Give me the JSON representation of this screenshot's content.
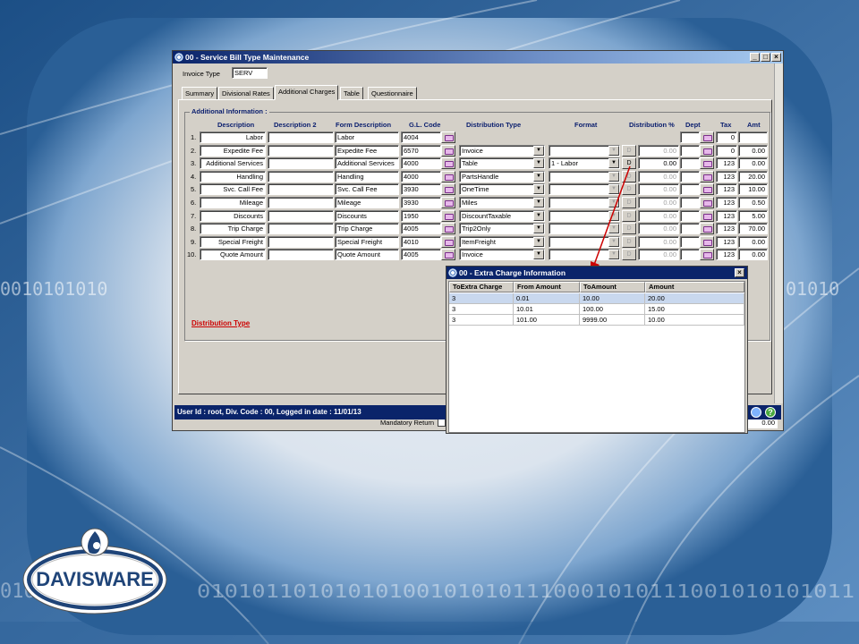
{
  "window": {
    "title": "00 - Service Bill Type Maintenance",
    "invoice_type_label": "Invoice Type",
    "invoice_type_value": "SERV"
  },
  "tabs": [
    {
      "label": "Summary"
    },
    {
      "label": "Divisional Rates"
    },
    {
      "label": "Additional Charges"
    },
    {
      "label": "Table"
    },
    {
      "label": "Questionnaire"
    }
  ],
  "section": {
    "title": "Additional Information :",
    "link": "Distribution Type"
  },
  "columns": {
    "description": "Description",
    "description2": "Description 2",
    "form_description": "Form Description",
    "gl_code": "G.L. Code",
    "distribution_type": "Distribution Type",
    "format": "Format",
    "distribution_pct": "Distribution %",
    "dept": "Dept",
    "tax": "Tax",
    "amt": "Amt"
  },
  "rows": [
    {
      "num": "1.",
      "desc": "Labor",
      "form": "Labor",
      "gl": "4004",
      "dist": "",
      "format": "",
      "d": "",
      "pct": "",
      "tax": "0",
      "amt": ""
    },
    {
      "num": "2.",
      "desc": "Expedite Fee",
      "form": "Expedite Fee",
      "gl": "6570",
      "dist": "Invoice",
      "format": "",
      "d": "D",
      "pct": "0.00",
      "tax": "0",
      "amt": "0.00"
    },
    {
      "num": "3.",
      "desc": "Additional Services",
      "form": "Additional Services",
      "gl": "4000",
      "dist": "Table",
      "format": "1 - Labor",
      "d": "D",
      "pct": "0.00",
      "tax": "123",
      "amt": "0.00"
    },
    {
      "num": "4.",
      "desc": "Handling",
      "form": "Handling",
      "gl": "4000",
      "dist": "PartsHandle",
      "format": "",
      "d": "D",
      "pct": "0.00",
      "tax": "123",
      "amt": "20.00"
    },
    {
      "num": "5.",
      "desc": "Svc. Call Fee",
      "form": "Svc. Call Fee",
      "gl": "3930",
      "dist": "OneTime",
      "format": "",
      "d": "D",
      "pct": "0.00",
      "tax": "123",
      "amt": "10.00"
    },
    {
      "num": "6.",
      "desc": "Mileage",
      "form": "Mileage",
      "gl": "3930",
      "dist": "Miles",
      "format": "",
      "d": "D",
      "pct": "0.00",
      "tax": "123",
      "amt": "0.50"
    },
    {
      "num": "7.",
      "desc": "Discounts",
      "form": "Discounts",
      "gl": "1950",
      "dist": "DiscountTaxable",
      "format": "",
      "d": "D",
      "pct": "0.00",
      "tax": "123",
      "amt": "5.00"
    },
    {
      "num": "8.",
      "desc": "Trip Charge",
      "form": "Trip Charge",
      "gl": "4005",
      "dist": "Trip2Only",
      "format": "",
      "d": "D",
      "pct": "0.00",
      "tax": "123",
      "amt": "70.00"
    },
    {
      "num": "9.",
      "desc": "Special Freight",
      "form": "Special Freight",
      "gl": "4010",
      "dist": "ItemFreight",
      "format": "",
      "d": "D",
      "pct": "0.00",
      "tax": "123",
      "amt": "0.00"
    },
    {
      "num": "10.",
      "desc": "Quote Amount",
      "form": "Quote Amount",
      "gl": "4005",
      "dist": "Invoice",
      "format": "",
      "d": "D",
      "pct": "0.00",
      "tax": "123",
      "amt": "0.00"
    }
  ],
  "status_bar": "User Id : root, Div. Code : 00, Logged in date : 11/01/13",
  "hidden_label": "Mandatory Return",
  "hidden_value": "0.00",
  "popup": {
    "title": "00 - Extra Charge Information",
    "columns": [
      "ToExtra Charge",
      "From Amount",
      "ToAmount",
      "Amount"
    ],
    "rows": [
      [
        "3",
        "0.01",
        "10.00",
        "20.00"
      ],
      [
        "3",
        "10.01",
        "100.00",
        "15.00"
      ],
      [
        "3",
        "101.00",
        "9999.00",
        "10.00"
      ]
    ]
  },
  "logo": {
    "text": "DAVISWARE"
  },
  "colors": {
    "titlebar": "#0a246a",
    "link_red": "#cc0000",
    "header_blue": "#0a1e6e",
    "arrow_red": "#cc0000"
  },
  "binary_strings": [
    "0010101010",
    "01010",
    "010101",
    "010101101010101001010101110001010111001010101011"
  ]
}
